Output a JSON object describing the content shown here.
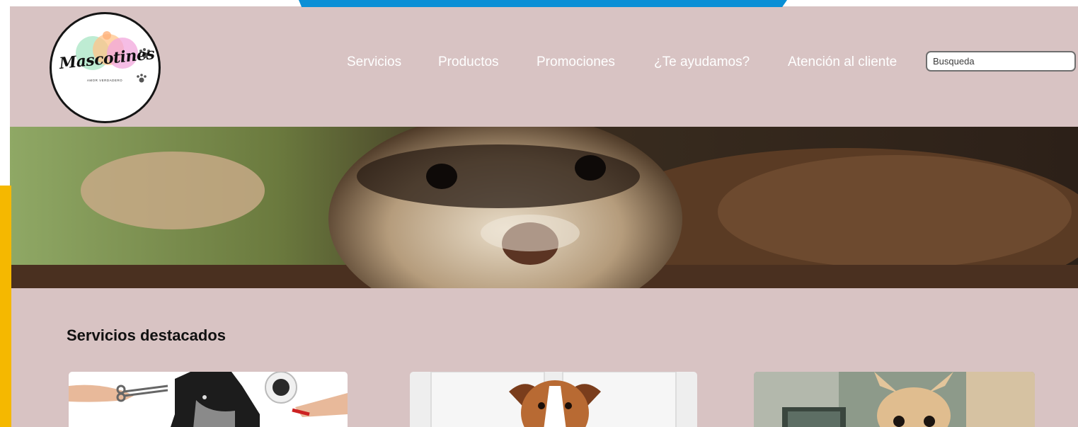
{
  "brand": {
    "name": "Mascotines",
    "tagline": "AMOR VERDADERO"
  },
  "nav": {
    "items": [
      {
        "label": "Servicios"
      },
      {
        "label": "Productos"
      },
      {
        "label": "Promociones"
      },
      {
        "label": "¿Te ayudamos?"
      },
      {
        "label": "Atención al cliente"
      }
    ]
  },
  "search": {
    "placeholder": "Busqueda"
  },
  "hero": {
    "image": "ferret-peeking-from-soil-photo"
  },
  "featured": {
    "title": "Servicios destacados",
    "cards": [
      {
        "image": "schnauzer-grooming-scissors-photo"
      },
      {
        "image": "beagle-jack-russell-dog-photo"
      },
      {
        "image": "chihuahua-dog-photo"
      }
    ]
  },
  "colors": {
    "page_background": "#d8c3c3",
    "nav_text": "#ffffff",
    "accent_blue": "#0a8fd6",
    "accent_yellow": "#f5b800"
  }
}
